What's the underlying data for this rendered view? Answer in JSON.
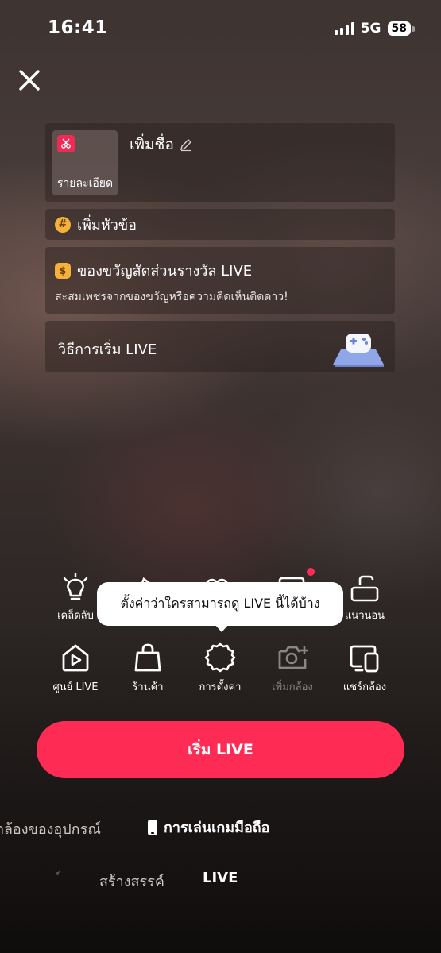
{
  "status": {
    "time": "16:41",
    "network": "5G",
    "battery": "58"
  },
  "card_title": {
    "thumb_label": "รายละเอียด",
    "name_placeholder": "เพิ่มชื่อ"
  },
  "topic": {
    "label": "เพิ่มหัวข้อ"
  },
  "gift": {
    "title": "ของขวัญสัดส่วนรางวัล LIVE",
    "subtitle": "สะสมเพชรจากของขวัญหรือความคิดเห็นติดดาว!"
  },
  "howto": {
    "label": "วิธีการเริ่ม LIVE"
  },
  "tools_row1": [
    {
      "label": "เคล็ดลับ"
    },
    {
      "label": "แนวนอน"
    }
  ],
  "tooltip": {
    "text": "ตั้งค่าว่าใครสามารถดู LIVE นี้ได้บ้าง"
  },
  "tools_row2": [
    {
      "label": "ศูนย์ LIVE"
    },
    {
      "label": "ร้านค้า"
    },
    {
      "label": "การตั้งค่า"
    },
    {
      "label": "เพิ่มกล้อง"
    },
    {
      "label": "แชร์กล้อง"
    }
  ],
  "start_button": {
    "label": "เริ่ม LIVE"
  },
  "modes": {
    "device_camera": "กล้องของอุปกรณ์",
    "mobile_gaming": "การเล่นเกมมือถือ"
  },
  "tabs": {
    "partial": "์",
    "create": "สร้างสรรค์",
    "live": "LIVE"
  },
  "colors": {
    "accent": "#fe2c55",
    "badge": "#f3b23a"
  }
}
